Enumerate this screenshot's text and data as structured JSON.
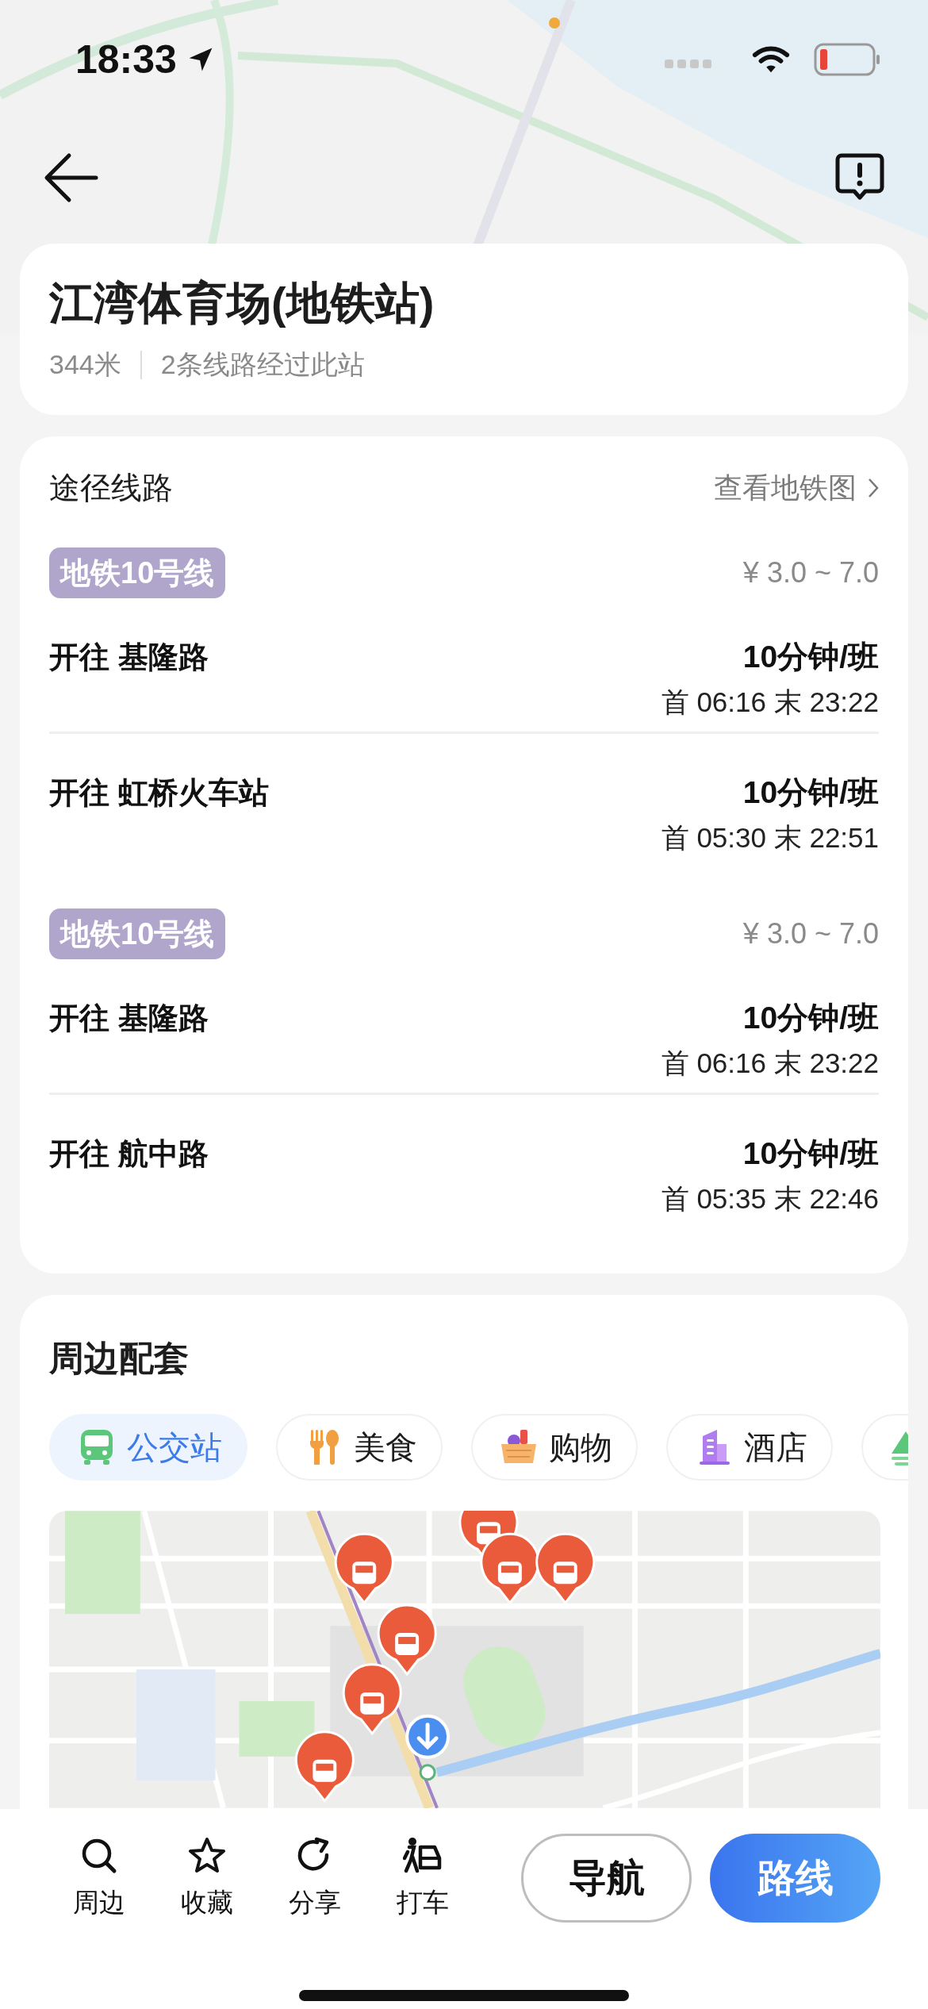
{
  "status_bar": {
    "time": "18:33"
  },
  "station": {
    "name": "江湾体育场(地铁站)",
    "distance": "344米",
    "summary": "2条线路经过此站"
  },
  "routes": {
    "title": "途径线路",
    "link": "查看地铁图",
    "lines": [
      {
        "name": "地铁10号线",
        "fare": "¥ 3.0 ~ 7.0",
        "directions": [
          {
            "destination": "开往 基隆路",
            "interval": "10分钟/班",
            "times": "首 06:16 末 23:22"
          },
          {
            "destination": "开往 虹桥火车站",
            "interval": "10分钟/班",
            "times": "首 05:30 末 22:51"
          }
        ]
      },
      {
        "name": "地铁10号线",
        "fare": "¥ 3.0 ~ 7.0",
        "directions": [
          {
            "destination": "开往 基隆路",
            "interval": "10分钟/班",
            "times": "首 06:16 末 23:22"
          },
          {
            "destination": "开往 航中路",
            "interval": "10分钟/班",
            "times": "首 05:35 末 22:46"
          }
        ]
      }
    ]
  },
  "nearby": {
    "title": "周边配套",
    "categories": [
      {
        "label": "公交站",
        "kind": "bus",
        "selected": true
      },
      {
        "label": "美食",
        "kind": "food",
        "selected": false
      },
      {
        "label": "购物",
        "kind": "shopping",
        "selected": false
      },
      {
        "label": "酒店",
        "kind": "hotel",
        "selected": false
      },
      {
        "kind": "scenic",
        "selected": false
      }
    ]
  },
  "toolbar": {
    "actions": [
      {
        "label": "周边",
        "kind": "search"
      },
      {
        "label": "收藏",
        "kind": "favorite"
      },
      {
        "label": "分享",
        "kind": "share"
      },
      {
        "label": "打车",
        "kind": "taxi"
      }
    ],
    "buttons": [
      {
        "label": "导航",
        "kind": "secondary"
      },
      {
        "label": "路线",
        "kind": "primary"
      }
    ]
  }
}
